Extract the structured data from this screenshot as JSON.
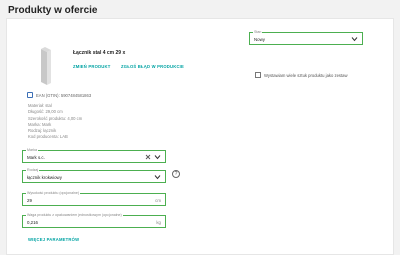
{
  "page": {
    "title": "Produkty w ofercie"
  },
  "product": {
    "name": "Łącznik stal 4 cm 29 x",
    "change_label": "ZMIEŃ PRODUKT",
    "report_label": "ZGŁOŚ BŁĄD W PRODUKCIE",
    "ean": "EAN (GTIN): 5907484581863",
    "specs": [
      "Materiał: stal",
      "Długość: 29,00 cm",
      "Szerokość produktu: 4,00 cm",
      "Marka: Mark",
      "Rodzaj: łącznik",
      "Kod producenta: LAB"
    ]
  },
  "condition": {
    "label": "Stan",
    "value": "Nowy"
  },
  "multi_units": {
    "label": "Wystawiam wiele sztuk produktu jako zestaw"
  },
  "brand": {
    "label": "Marka",
    "value": "Mark s.c.",
    "help": "?"
  },
  "kind": {
    "label": "Rodzaj",
    "value": "łącznik krokwiowy"
  },
  "height": {
    "label": "Wysokość produktu (opcjonalne)",
    "value": "29",
    "unit": "cm"
  },
  "weight": {
    "label": "Waga produktu z opakowaniem jednostkowym (opcjonalne)",
    "value": "0,216",
    "unit": "kg"
  },
  "more_params": {
    "label": "WIĘCEJ PARAMETRÓW"
  },
  "colors": {
    "accent": "#00a3a3",
    "valid": "#4caf50"
  }
}
